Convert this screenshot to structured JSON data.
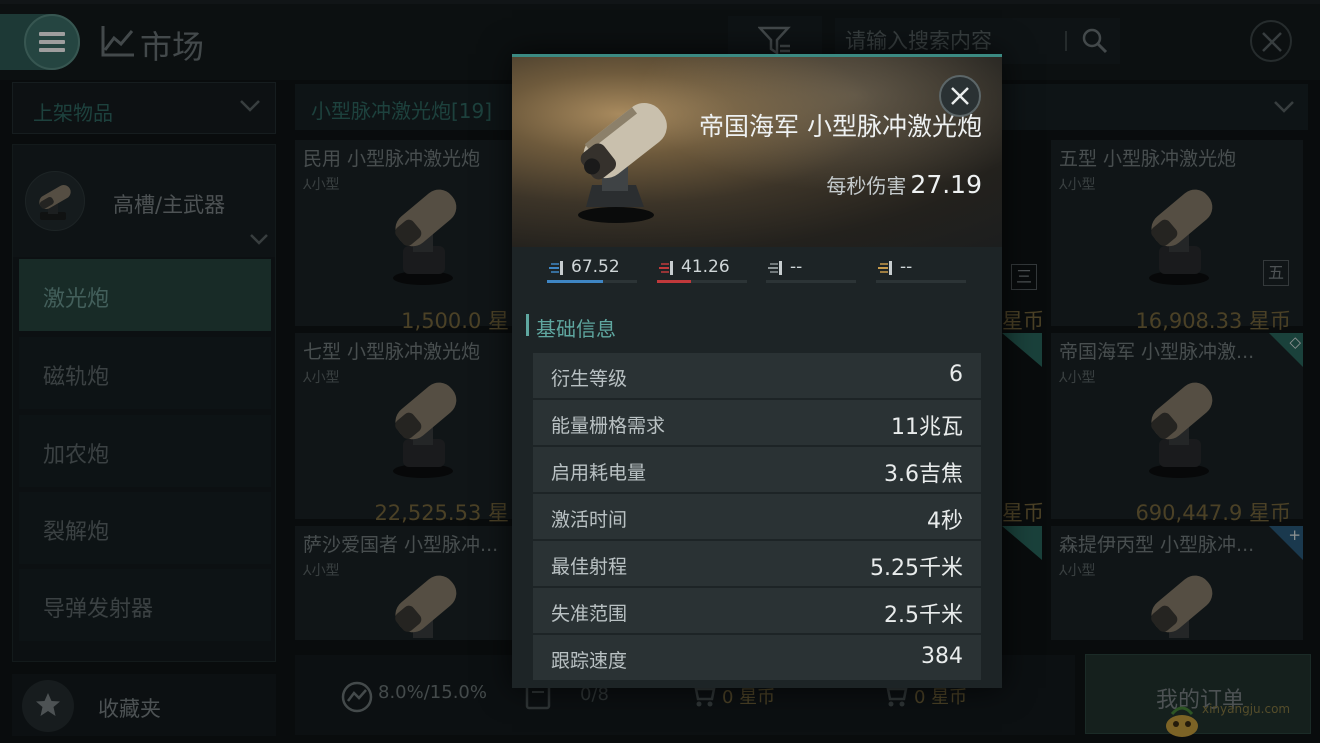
{
  "topbar": {
    "title": "市场",
    "search_placeholder": "请输入搜索内容"
  },
  "sidebar": {
    "dropdown_label": "上架物品",
    "category_label": "高槽/主武器",
    "items": [
      {
        "label": "激光炮",
        "active": true
      },
      {
        "label": "磁轨炮",
        "active": false
      },
      {
        "label": "加农炮",
        "active": false
      },
      {
        "label": "裂解炮",
        "active": false
      },
      {
        "label": "导弹发射器",
        "active": false
      }
    ],
    "favorites_label": "收藏夹"
  },
  "list": {
    "header": "小型脉冲激光炮[19]",
    "cards": [
      {
        "name": "民用 小型脉冲激光炮",
        "size": "小型",
        "price": "1,500.0 星"
      },
      {
        "name": "五型 小型脉冲激光炮",
        "size": "小型",
        "badge": "五",
        "price": "16,908.33 星币"
      },
      {
        "name": "七型 小型脉冲激光炮",
        "size": "小型",
        "price": "22,525.53 星"
      },
      {
        "name": "帝国海军 小型脉冲激...",
        "size": "小型",
        "price": "690,447.9 星币"
      },
      {
        "name": "萨沙爱国者 小型脉冲...",
        "size": "小型"
      },
      {
        "name": "森提伊丙型 小型脉冲...",
        "size": "小型"
      }
    ],
    "partial_badge": "三",
    "partial_prices": [
      "星币",
      "星币"
    ]
  },
  "bottom": {
    "ratio": "8.0%/15.0%",
    "orders_count": "0/8",
    "cart_buy": "0 星币",
    "cart_sell": "0 星币",
    "my_orders": "我的订单",
    "watermark": "xinyangju.com"
  },
  "modal": {
    "name": "帝国海军 小型脉冲激光炮",
    "dps_label": "每秒伤害",
    "dps_value": "27.19",
    "damage": [
      {
        "type": "em",
        "value": "67.52",
        "fill": 0.62,
        "color": "#3f86c4"
      },
      {
        "type": "thermal",
        "value": "41.26",
        "fill": 0.38,
        "color": "#c0393b"
      },
      {
        "type": "kinetic",
        "value": "--",
        "fill": 0,
        "color": "#8c9496"
      },
      {
        "type": "explosive",
        "value": "--",
        "fill": 0,
        "color": "#c89b4a"
      }
    ],
    "section_title": "基础信息",
    "rows": [
      {
        "key": "衍生等级",
        "value": "6"
      },
      {
        "key": "能量栅格需求",
        "value": "11兆瓦"
      },
      {
        "key": "启用耗电量",
        "value": "3.6吉焦"
      },
      {
        "key": "激活时间",
        "value": "4秒"
      },
      {
        "key": "最佳射程",
        "value": "5.25千米"
      },
      {
        "key": "失准范围",
        "value": "2.5千米"
      },
      {
        "key": "跟踪速度",
        "value": "384"
      }
    ]
  }
}
